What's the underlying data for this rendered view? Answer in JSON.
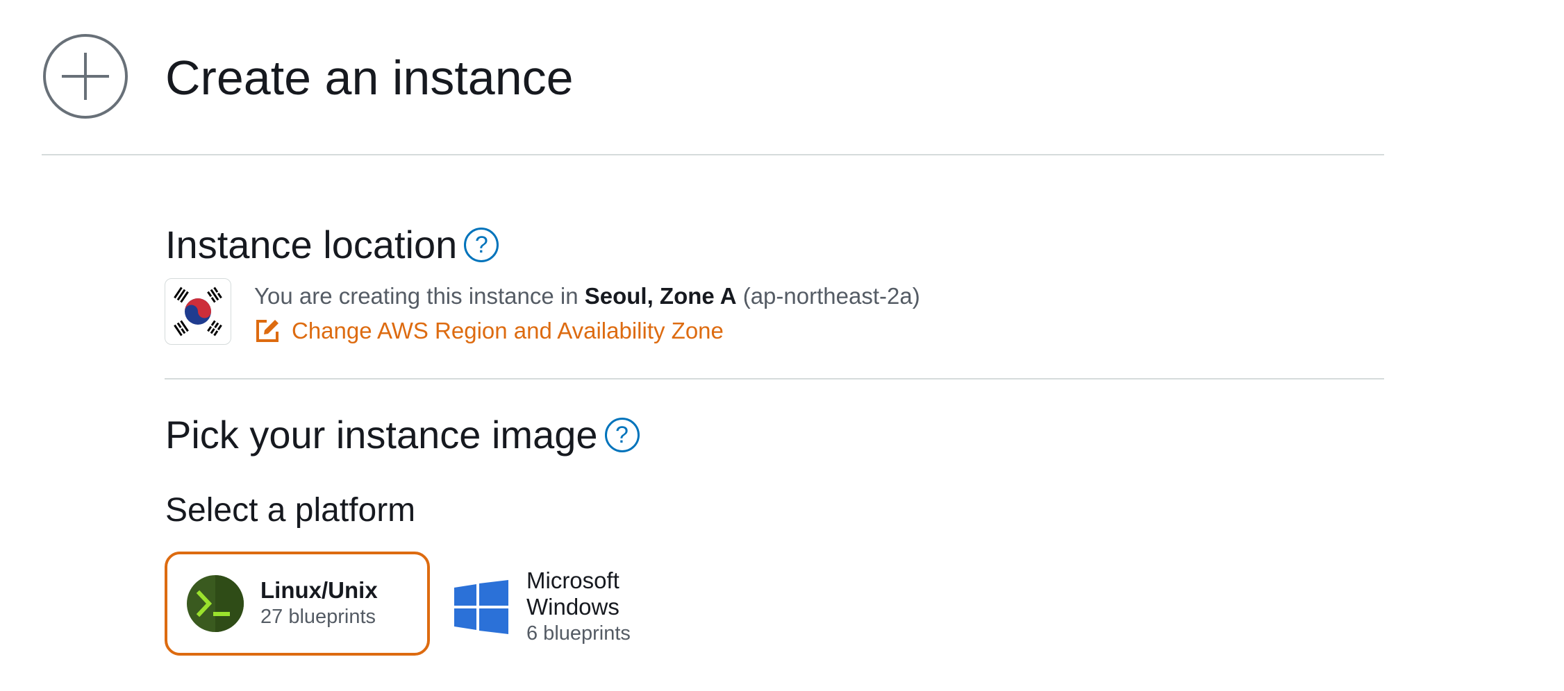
{
  "header": {
    "title": "Create an instance",
    "icon": "add-circle-icon"
  },
  "location": {
    "title": "Instance location",
    "help_symbol": "?",
    "description_prefix": "You are creating this instance in",
    "region_name": "Seoul, Zone A",
    "region_code": "(ap-northeast-2a)",
    "change_link": "Change AWS Region and Availability Zone",
    "flag_icon": "south-korea-flag-icon"
  },
  "image": {
    "title": "Pick your instance image",
    "help_symbol": "?",
    "platform_label": "Select a platform",
    "platforms": [
      {
        "name": "Linux/Unix",
        "count": "27 blueprints",
        "icon": "terminal-icon",
        "selected": true
      },
      {
        "name_line1": "Microsoft",
        "name_line2": "Windows",
        "count": "6 blueprints",
        "icon": "windows-logo-icon",
        "selected": false
      }
    ]
  },
  "colors": {
    "accent_orange": "#dd6b10",
    "help_blue": "#0073bb",
    "text_dark": "#16191f",
    "text_muted": "#545b64",
    "divider": "#d5dbdb",
    "terminal_bg": "#3a5a1f",
    "terminal_glyph": "#9be22d",
    "windows_blue": "#2b71d8"
  }
}
